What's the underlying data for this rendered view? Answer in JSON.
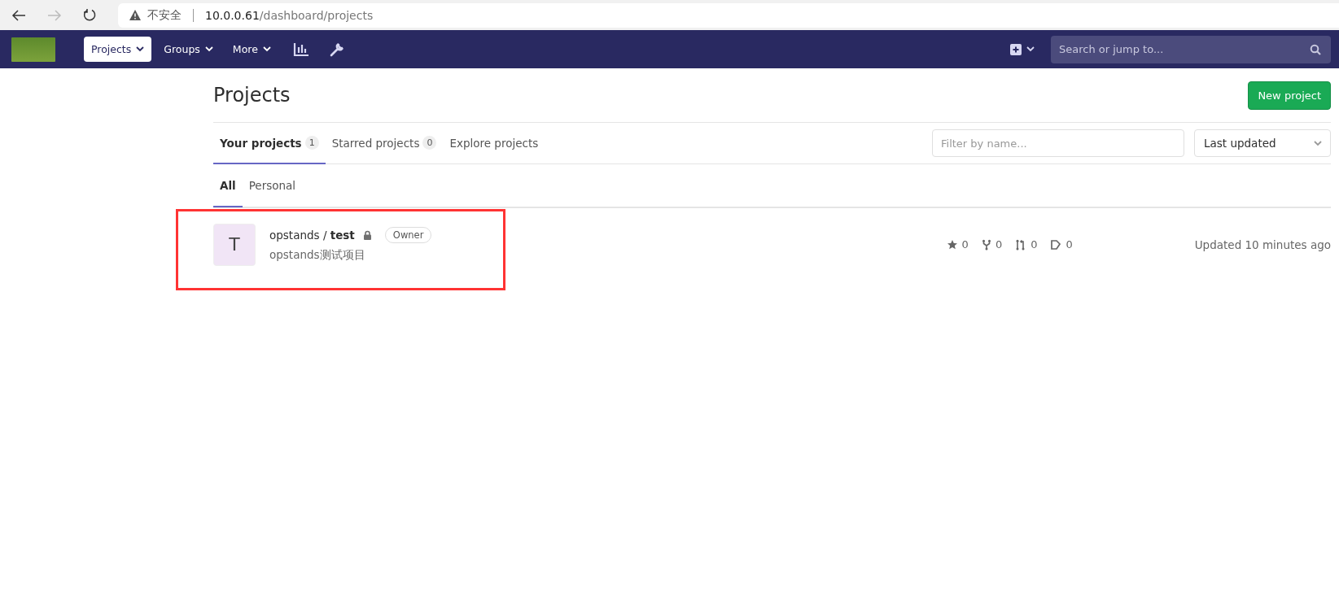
{
  "browser": {
    "security_label": "不安全",
    "url_host": "10.0.0.61",
    "url_path": "/dashboard/projects"
  },
  "navbar": {
    "items": [
      {
        "label": "Projects",
        "selected": true
      },
      {
        "label": "Groups",
        "selected": false
      },
      {
        "label": "More",
        "selected": false
      }
    ],
    "search": {
      "placeholder": "Search or jump to..."
    }
  },
  "page": {
    "title": "Projects",
    "new_button": "New project"
  },
  "tabs": [
    {
      "label": "Your projects",
      "count": "1",
      "selected": true
    },
    {
      "label": "Starred projects",
      "count": "0",
      "selected": false
    },
    {
      "label": "Explore projects",
      "selected": false
    }
  ],
  "filter": {
    "placeholder": "Filter by name..."
  },
  "sort": {
    "value": "Last updated"
  },
  "subtabs": [
    {
      "label": "All",
      "selected": true
    },
    {
      "label": "Personal",
      "selected": false
    }
  ],
  "projects": [
    {
      "avatar": "T",
      "namespace": "opstands / ",
      "name": "test",
      "private": true,
      "role": "Owner",
      "description": "opstands测试项目",
      "highlighted": true,
      "stats": [
        {
          "kind": "star",
          "value": "0"
        },
        {
          "kind": "fork",
          "value": "0"
        },
        {
          "kind": "merge",
          "value": "0"
        },
        {
          "kind": "issue",
          "value": "0"
        }
      ],
      "updated": "Updated 10 minutes ago"
    }
  ]
}
